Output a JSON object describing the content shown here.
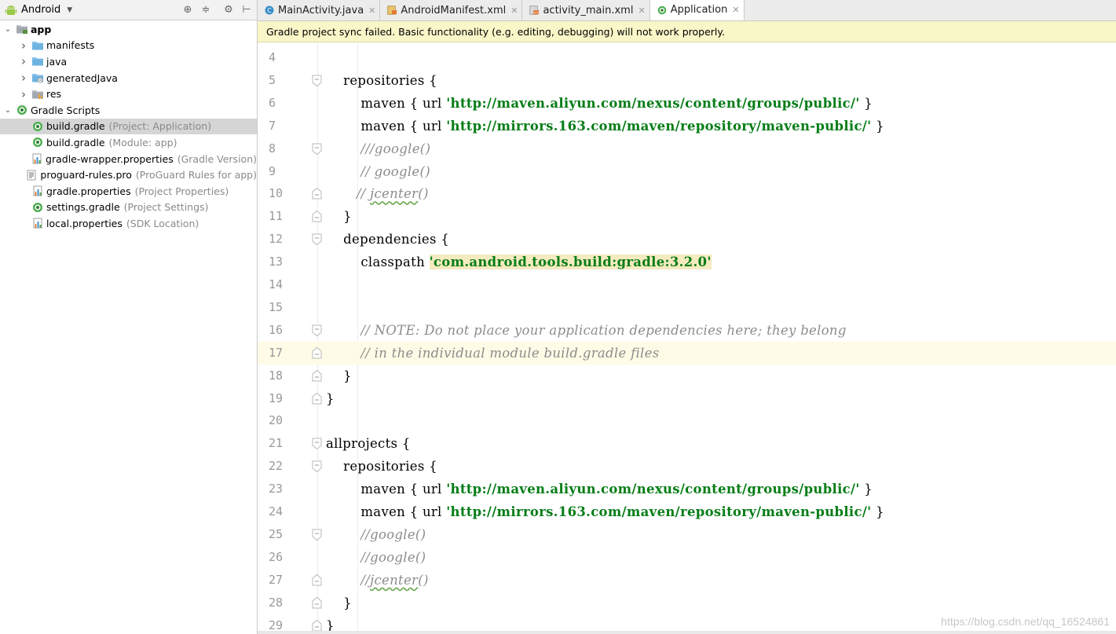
{
  "project_panel": {
    "view_name": "Android",
    "tree": [
      {
        "name": "app",
        "detail": "",
        "depth": 0,
        "arrow": "expanded",
        "icon": "module-folder-icon",
        "bold": true
      },
      {
        "name": "manifests",
        "detail": "",
        "depth": 1,
        "arrow": "collapsed",
        "icon": "folder-icon"
      },
      {
        "name": "java",
        "detail": "",
        "depth": 1,
        "arrow": "collapsed",
        "icon": "folder-icon"
      },
      {
        "name": "generatedJava",
        "detail": "",
        "depth": 1,
        "arrow": "collapsed",
        "icon": "generated-folder-icon"
      },
      {
        "name": "res",
        "detail": "",
        "depth": 1,
        "arrow": "collapsed",
        "icon": "res-folder-icon"
      },
      {
        "name": "Gradle Scripts",
        "detail": "",
        "depth": 0,
        "arrow": "expanded",
        "icon": "gradle-icon"
      },
      {
        "name": "build.gradle",
        "detail": "(Project: Application)",
        "depth": 1,
        "arrow": "none",
        "icon": "gradle-icon",
        "selected": true
      },
      {
        "name": "build.gradle",
        "detail": "(Module: app)",
        "depth": 1,
        "arrow": "none",
        "icon": "gradle-icon"
      },
      {
        "name": "gradle-wrapper.properties",
        "detail": "(Gradle Version)",
        "depth": 1,
        "arrow": "none",
        "icon": "properties-icon"
      },
      {
        "name": "proguard-rules.pro",
        "detail": "(ProGuard Rules for app)",
        "depth": 1,
        "arrow": "none",
        "icon": "text-file-icon"
      },
      {
        "name": "gradle.properties",
        "detail": "(Project Properties)",
        "depth": 1,
        "arrow": "none",
        "icon": "properties-icon"
      },
      {
        "name": "settings.gradle",
        "detail": "(Project Settings)",
        "depth": 1,
        "arrow": "none",
        "icon": "gradle-icon"
      },
      {
        "name": "local.properties",
        "detail": "(SDK Location)",
        "depth": 1,
        "arrow": "none",
        "icon": "properties-icon"
      }
    ]
  },
  "tabs": [
    {
      "label": "MainActivity.java",
      "icon": "java-class-icon",
      "active": false
    },
    {
      "label": "AndroidManifest.xml",
      "icon": "manifest-icon",
      "active": false
    },
    {
      "label": "activity_main.xml",
      "icon": "layout-xml-icon",
      "active": false
    },
    {
      "label": "Application",
      "icon": "gradle-icon",
      "active": true
    }
  ],
  "banner": {
    "text": "Gradle project sync failed. Basic functionality (e.g. editing, debugging) will not work properly."
  },
  "editor": {
    "current_line": 17,
    "lines": [
      {
        "n": "4",
        "fold": false,
        "parts": []
      },
      {
        "n": "5",
        "fold": "open",
        "parts": [
          {
            "t": "    repositories {",
            "c": ""
          }
        ]
      },
      {
        "n": "6",
        "fold": false,
        "parts": [
          {
            "t": "        maven { url ",
            "c": ""
          },
          {
            "t": "'http://maven.aliyun.com/nexus/content/groups/public/'",
            "c": "str"
          },
          {
            "t": " }",
            "c": ""
          }
        ]
      },
      {
        "n": "7",
        "fold": false,
        "parts": [
          {
            "t": "        maven { url ",
            "c": ""
          },
          {
            "t": "'http://mirrors.163.com/maven/repository/maven-public/'",
            "c": "str"
          },
          {
            "t": " }",
            "c": ""
          }
        ]
      },
      {
        "n": "8",
        "fold": "open",
        "parts": [
          {
            "t": "        ///google()",
            "c": "cmt"
          }
        ]
      },
      {
        "n": "9",
        "fold": false,
        "parts": [
          {
            "t": "        // google()",
            "c": "cmt"
          }
        ]
      },
      {
        "n": "10",
        "fold": "close",
        "parts": [
          {
            "t": "       // ",
            "c": "cmt"
          },
          {
            "t": "jcenter",
            "c": "cmt squig"
          },
          {
            "t": "()",
            "c": "cmt"
          }
        ]
      },
      {
        "n": "11",
        "fold": "close",
        "parts": [
          {
            "t": "    }",
            "c": ""
          }
        ]
      },
      {
        "n": "12",
        "fold": "open",
        "parts": [
          {
            "t": "    dependencies {",
            "c": ""
          }
        ]
      },
      {
        "n": "13",
        "fold": false,
        "parts": [
          {
            "t": "        classpath ",
            "c": ""
          },
          {
            "t": "'com.android.tools.build:gradle:3.2.0'",
            "c": "str hl"
          }
        ]
      },
      {
        "n": "14",
        "fold": false,
        "parts": []
      },
      {
        "n": "15",
        "fold": false,
        "parts": []
      },
      {
        "n": "16",
        "fold": "open",
        "parts": [
          {
            "t": "        // NOTE: Do not place your application dependencies here; they belong",
            "c": "cmt"
          }
        ]
      },
      {
        "n": "17",
        "fold": "close",
        "parts": [
          {
            "t": "        // in the individual module build.gradle files",
            "c": "cmt"
          }
        ]
      },
      {
        "n": "18",
        "fold": "close",
        "parts": [
          {
            "t": "    }",
            "c": ""
          }
        ]
      },
      {
        "n": "19",
        "fold": "close",
        "parts": [
          {
            "t": "}",
            "c": ""
          }
        ]
      },
      {
        "n": "20",
        "fold": false,
        "parts": []
      },
      {
        "n": "21",
        "fold": "open",
        "parts": [
          {
            "t": "allprojects {",
            "c": ""
          }
        ]
      },
      {
        "n": "22",
        "fold": "open",
        "parts": [
          {
            "t": "    repositories {",
            "c": ""
          }
        ]
      },
      {
        "n": "23",
        "fold": false,
        "parts": [
          {
            "t": "        maven { url ",
            "c": ""
          },
          {
            "t": "'http://maven.aliyun.com/nexus/content/groups/public/'",
            "c": "str"
          },
          {
            "t": " }",
            "c": ""
          }
        ]
      },
      {
        "n": "24",
        "fold": false,
        "parts": [
          {
            "t": "        maven { url ",
            "c": ""
          },
          {
            "t": "'http://mirrors.163.com/maven/repository/maven-public/'",
            "c": "str"
          },
          {
            "t": " }",
            "c": ""
          }
        ]
      },
      {
        "n": "25",
        "fold": "open",
        "parts": [
          {
            "t": "        //google()",
            "c": "cmt"
          }
        ]
      },
      {
        "n": "26",
        "fold": false,
        "parts": [
          {
            "t": "        //google()",
            "c": "cmt"
          }
        ]
      },
      {
        "n": "27",
        "fold": "close",
        "parts": [
          {
            "t": "        //",
            "c": "cmt"
          },
          {
            "t": "jcenter",
            "c": "cmt squig"
          },
          {
            "t": "()",
            "c": "cmt"
          }
        ]
      },
      {
        "n": "28",
        "fold": "close",
        "parts": [
          {
            "t": "    }",
            "c": ""
          }
        ]
      },
      {
        "n": "29",
        "fold": "close",
        "parts": [
          {
            "t": "}",
            "c": ""
          }
        ]
      }
    ]
  },
  "watermark": "https://blog.csdn.net/qq_16524861"
}
